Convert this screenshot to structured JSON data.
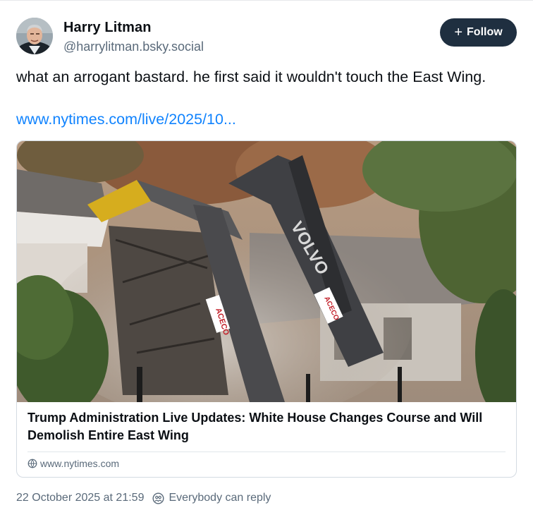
{
  "author": {
    "name": "Harry Litman",
    "handle": "@harrylitman.bsky.social",
    "avatar_icon": "avatar-photo"
  },
  "follow_button": {
    "icon": "plus-icon",
    "label": "Follow"
  },
  "post": {
    "text": "what an arrogant bastard.  he first said it wouldn't touch the East Wing.",
    "link_text": "www.nytimes.com/live/2025/10..."
  },
  "embed": {
    "image_icon": "demolition-photo",
    "image_labels": {
      "volvo": "VOLVO",
      "aceco_1": "ACECO",
      "aceco_2": "ACECO"
    },
    "title": "Trump Administration Live Updates: White House Changes Course and Will Demolish Entire East Wing",
    "domain": "www.nytimes.com",
    "domain_icon": "globe-icon"
  },
  "meta": {
    "timestamp": "22 October 2025 at 21:59",
    "reply_setting": "Everybody can reply",
    "reply_icon": "reply-setting-icon"
  },
  "colors": {
    "link": "#1083fe",
    "follow_bg": "#1f2f40",
    "muted_text": "#5a6a7a",
    "border": "#d4dbe2"
  }
}
